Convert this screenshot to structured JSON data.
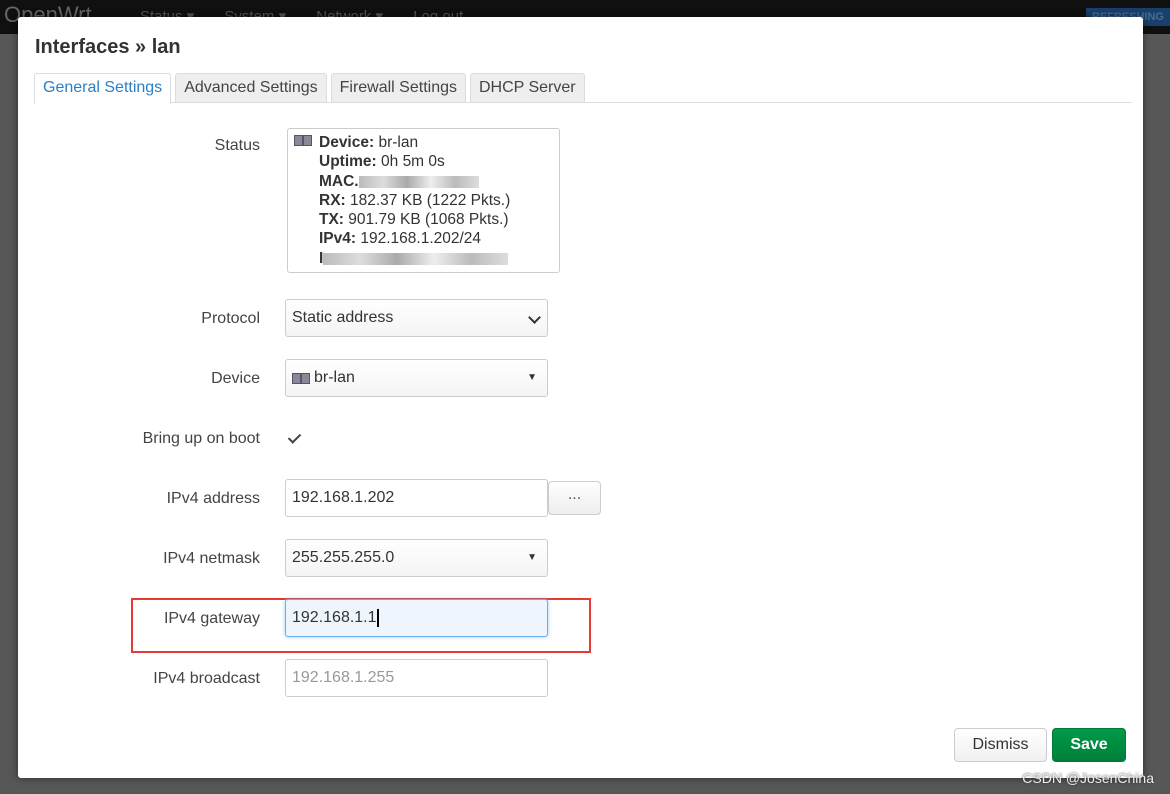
{
  "topbar": {
    "brand": "OpenWrt",
    "nav": [
      "Status ▾",
      "System ▾",
      "Network ▾",
      "Log out"
    ],
    "badge": "REFRESHING"
  },
  "modal": {
    "title": "Interfaces » lan",
    "tabs": [
      {
        "label": "General Settings",
        "active": true
      },
      {
        "label": "Advanced Settings"
      },
      {
        "label": "Firewall Settings"
      },
      {
        "label": "DHCP Server"
      }
    ],
    "status": {
      "label": "Status",
      "device_label": "Device:",
      "device": "br-lan",
      "uptime_label": "Uptime:",
      "uptime": "0h 5m 0s",
      "mac_label": "MAC.",
      "rx_label": "RX:",
      "rx": "182.37 KB (1222 Pkts.)",
      "tx_label": "TX:",
      "tx": "901.79 KB (1068 Pkts.)",
      "ipv4_label": "IPv4:",
      "ipv4": "192.168.1.202/24",
      "ipv6_label": "I"
    },
    "protocol": {
      "label": "Protocol",
      "value": "Static address"
    },
    "device": {
      "label": "Device",
      "value": "br-lan"
    },
    "boot": {
      "label": "Bring up on boot",
      "checked": true
    },
    "ipv4_address": {
      "label": "IPv4 address",
      "value": "192.168.1.202",
      "more": "..."
    },
    "ipv4_netmask": {
      "label": "IPv4 netmask",
      "value": "255.255.255.0"
    },
    "ipv4_gateway": {
      "label": "IPv4 gateway",
      "value": "192.168.1.1"
    },
    "ipv4_broadcast": {
      "label": "IPv4 broadcast",
      "placeholder": "192.168.1.255"
    },
    "buttons": {
      "dismiss": "Dismiss",
      "save": "Save"
    },
    "colors": {
      "accent": "#2a7fc7",
      "save": "#00873e",
      "highlight": "#e53935"
    }
  },
  "watermark": "CSDN @JosenChina"
}
